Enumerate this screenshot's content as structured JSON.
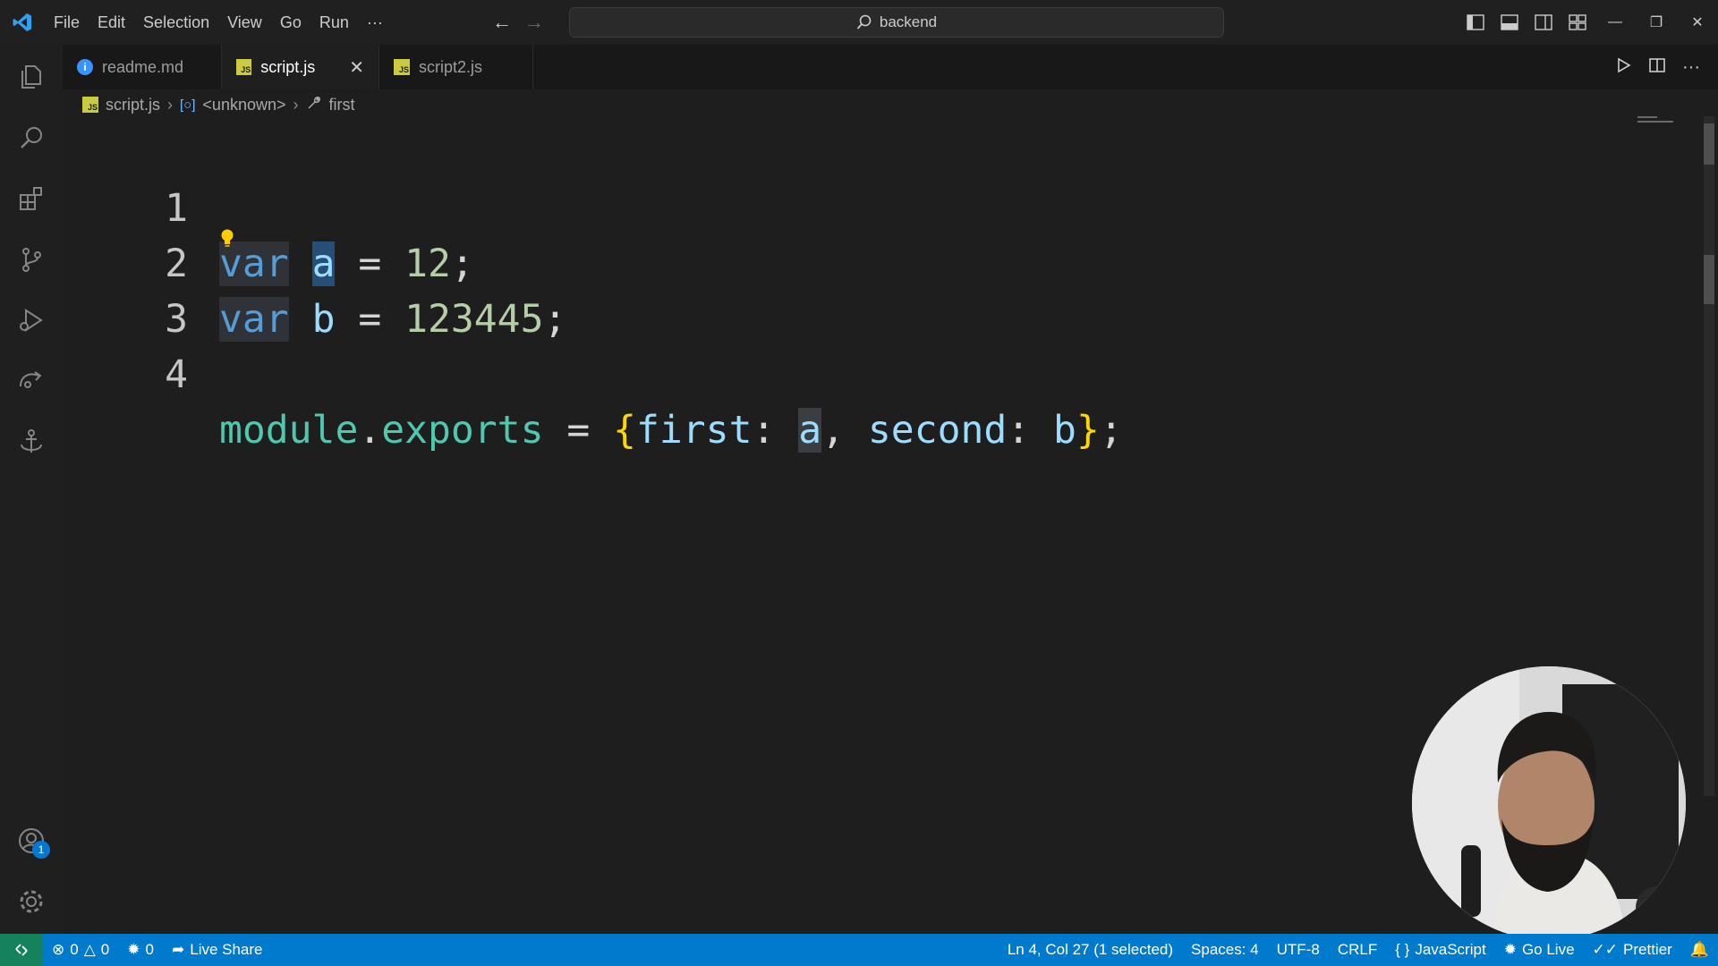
{
  "titlebar": {
    "menu": [
      "File",
      "Edit",
      "Selection",
      "View",
      "Go",
      "Run",
      "···"
    ],
    "search_text": "backend"
  },
  "tabs": [
    {
      "label": "readme.md",
      "icon": "info-icon",
      "active": false
    },
    {
      "label": "script.js",
      "icon": "js-file-icon",
      "active": true
    },
    {
      "label": "script2.js",
      "icon": "js-file-icon",
      "active": false
    }
  ],
  "breadcrumb": {
    "file": "script.js",
    "scope": "<unknown>",
    "symbol": "first"
  },
  "editor": {
    "lines": [
      {
        "num": "1"
      },
      {
        "num": "2"
      },
      {
        "num": "3"
      },
      {
        "num": "4"
      }
    ],
    "tokens": {
      "var": "var",
      "a": "a",
      "b": "b",
      "eq": "=",
      "semi": ";",
      "n1": "12",
      "n2": "123445",
      "module": "module",
      "dot": ".",
      "exports": "exports",
      "lbrace": "{",
      "rbrace": "}",
      "first": "first",
      "second": "second",
      "colon": ":",
      "comma": ","
    }
  },
  "activitybar": {
    "accounts_badge": "1"
  },
  "statusbar": {
    "errors": "0",
    "warnings": "0",
    "ports": "0",
    "live_share": "Live Share",
    "cursor": "Ln 4, Col 27 (1 selected)",
    "spaces": "Spaces: 4",
    "encoding": "UTF-8",
    "eol": "CRLF",
    "language": "JavaScript",
    "go_live": "Go Live",
    "prettier": "Prettier"
  },
  "colors": {
    "accent": "#007acc",
    "keyword": "#569cd6",
    "variable": "#9cdcfe",
    "number": "#b5cea8",
    "module": "#4ec9b0",
    "brace": "#ffd700"
  }
}
